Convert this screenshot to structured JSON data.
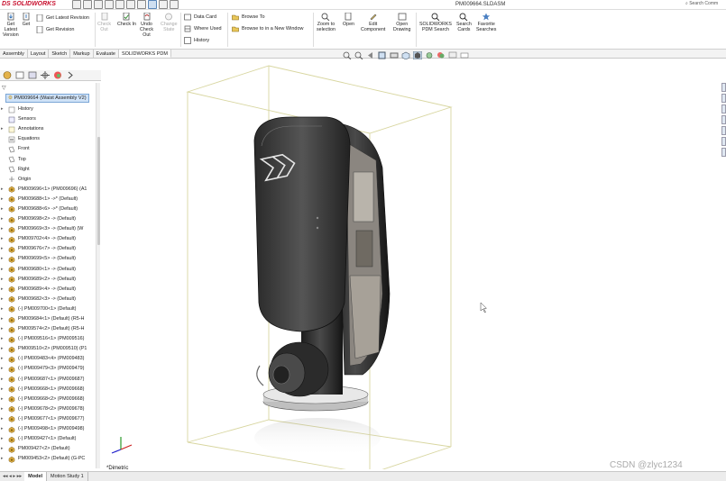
{
  "app": {
    "logo_ds": "DS",
    "logo_text": "SOLIDWORKS",
    "document_title": "PM009664.SLDASM",
    "search_placeholder": "Search Comm"
  },
  "ribbon": {
    "get_latest_version": "Get\nLatest\nVersion",
    "get": "Get",
    "get_latest_revision": "Get Latest Revision",
    "get_revision": "Get Revision",
    "check_out": "Check\nOut",
    "check_in": "Check In",
    "undo_check_out": "Undo\nCheck\nOut",
    "change_state": "Change\nState",
    "data_card": "Data Card",
    "where_used": "Where Used",
    "history": "History",
    "browse_to": "Browse To",
    "browse_to_new_window": "Browse to in a New Window",
    "zoom_to_selection": "Zoom to\nselection",
    "open": "Open",
    "edit_component": "Edit\nComponent",
    "open_drawing": "Open\nDrawing",
    "pdm_search": "SOLIDWORKS\nPDM Search",
    "search_cards": "Search\nCards",
    "favorite_searches": "Favorite\nSearches"
  },
  "tabs": [
    "Assembly",
    "Layout",
    "Sketch",
    "Markup",
    "Evaluate",
    "SOLIDWORKS PDM"
  ],
  "active_tab": "SOLIDWORKS PDM",
  "tree": {
    "root": "PM009664 (Waist Assembly V2)",
    "items": [
      {
        "label": "History",
        "icon": "history-icon",
        "arrow": true
      },
      {
        "label": "Sensors",
        "icon": "sensors-icon",
        "arrow": false
      },
      {
        "label": "Annotations",
        "icon": "annotations-icon",
        "arrow": true
      },
      {
        "label": "Equations",
        "icon": "equations-icon",
        "arrow": false
      },
      {
        "label": "Front",
        "icon": "plane-icon",
        "arrow": false
      },
      {
        "label": "Top",
        "icon": "plane-icon",
        "arrow": false
      },
      {
        "label": "Right",
        "icon": "plane-icon",
        "arrow": false
      },
      {
        "label": "Origin",
        "icon": "origin-icon",
        "arrow": false
      },
      {
        "label": "PM009696<1> (PM009696) (A1",
        "icon": "component-icon",
        "arrow": true
      },
      {
        "label": "PM009688<1> ->* (Default)",
        "icon": "component-icon",
        "arrow": true
      },
      {
        "label": "PM009688<6> ->* (Default)",
        "icon": "component-icon",
        "arrow": true
      },
      {
        "label": "PM009698<2> -> (Default)",
        "icon": "component-icon",
        "arrow": true
      },
      {
        "label": "PM009669<3> -> (Default) (W",
        "icon": "component-icon",
        "arrow": true
      },
      {
        "label": "PM009702<4> -> (Default)",
        "icon": "component-icon",
        "arrow": true
      },
      {
        "label": "PM009676<7> -> (Default)",
        "icon": "component-icon",
        "arrow": true
      },
      {
        "label": "PM009699<5> -> (Default)",
        "icon": "component-icon",
        "arrow": true
      },
      {
        "label": "PM009680<1> -> (Default)",
        "icon": "component-icon",
        "arrow": true
      },
      {
        "label": "PM009689<2> -> (Default)",
        "icon": "component-icon",
        "arrow": true
      },
      {
        "label": "PM009689<4> -> (Default)",
        "icon": "component-icon",
        "arrow": true
      },
      {
        "label": "PM009682<3> -> (Default)",
        "icon": "component-icon",
        "arrow": true
      },
      {
        "label": "(-) PM009700<1> (Default)",
        "icon": "component-icon",
        "arrow": true
      },
      {
        "label": "PM009684<1> (Default) (R5-H",
        "icon": "component-icon",
        "arrow": true
      },
      {
        "label": "PM009574<2> (Default) (R5-H",
        "icon": "component-icon",
        "arrow": true
      },
      {
        "label": "(-) PM009516<1> (PM009516)",
        "icon": "component-icon",
        "arrow": true
      },
      {
        "label": "PM009510<2> (PM009510) (P1",
        "icon": "component-icon",
        "arrow": true
      },
      {
        "label": "(-) PM009483<4> (PM009483)",
        "icon": "component-icon",
        "arrow": true
      },
      {
        "label": "(-) PM009479<3> (PM009479)",
        "icon": "component-icon",
        "arrow": true
      },
      {
        "label": "(-) PM009687<1> (PM009687)",
        "icon": "component-icon",
        "arrow": true
      },
      {
        "label": "(-) PM009668<1> (PM009668)",
        "icon": "component-icon",
        "arrow": true
      },
      {
        "label": "(-) PM009668<2> (PM009668)",
        "icon": "component-icon",
        "arrow": true
      },
      {
        "label": "(-) PM009678<2> (PM009678)",
        "icon": "component-icon",
        "arrow": true
      },
      {
        "label": "(-) PM009677<1> (PM009677)",
        "icon": "component-icon",
        "arrow": true
      },
      {
        "label": "(-) PM009498<1> (PM009498)",
        "icon": "component-icon",
        "arrow": true
      },
      {
        "label": "(-) PM009427<1> (Default)",
        "icon": "component-icon",
        "arrow": true
      },
      {
        "label": "PM009427<2> (Default)",
        "icon": "component-icon",
        "arrow": true
      },
      {
        "label": "PM009453<2> (Default) (G-PC",
        "icon": "component-icon",
        "arrow": true
      }
    ]
  },
  "bottom_tabs": [
    "Model",
    "Motion Study 1"
  ],
  "active_bottom_tab": "Model",
  "view_label": "*Dimetric",
  "watermark": "CSDN @zlyc1234",
  "colors": {
    "accent": "#5a86b8",
    "selection": "#cfe2f7",
    "bbox_line": "#d8d6a0",
    "part_dark": "#2a2a2a"
  }
}
